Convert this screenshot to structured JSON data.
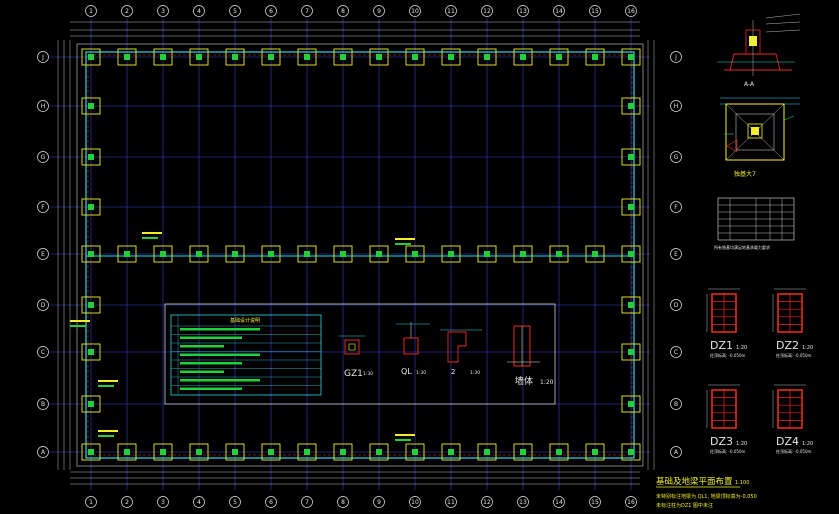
{
  "colors": {
    "background": "#000000",
    "axis_line": "#3a3fd8",
    "grid_blue": "#2a2f9a",
    "outline": "#8c8c8c",
    "green": "#22d03a",
    "yellow": "#f2ef2a",
    "red": "#e8281e",
    "cyan": "#2fd6e6",
    "white": "#e6e6e6",
    "magenta": "#d43ad4"
  },
  "plan": {
    "col_labels": [
      "1",
      "2",
      "3",
      "4",
      "5",
      "6",
      "7",
      "8",
      "9",
      "10",
      "11",
      "12",
      "13",
      "14",
      "15",
      "16"
    ],
    "row_labels": [
      "J",
      "H",
      "G",
      "F",
      "E",
      "D",
      "C",
      "B",
      "A"
    ],
    "title": "基础及地梁平面布置",
    "title_scale": "1:100",
    "note_line1": "未特别标注地梁为 QL1, 地梁顶标高为-0.050",
    "note_line2": "未标注柱为DZ1  图中未注"
  },
  "notes_table": {
    "header": "基础设计说明"
  },
  "sections": {
    "gz1": "GZ1",
    "gz1_scale": "1:30",
    "ql": "QL",
    "ql_scale": "1:30",
    "detail_num": "2",
    "detail_scale": "1:30",
    "wall": "墙体",
    "wall_scale": "1:20"
  },
  "details": {
    "a_a": "A-A",
    "jiangda": "独基大7",
    "table_note": "所有独基均满足地基承载力要求"
  },
  "columns": [
    {
      "name": "DZ1",
      "scale": "1:20",
      "note": "柱顶标高: -0.050m"
    },
    {
      "name": "DZ2",
      "scale": "1:20",
      "note": "柱顶标高: -0.050m"
    },
    {
      "name": "DZ3",
      "scale": "1:20",
      "note": "柱顶标高: -0.050m"
    },
    {
      "name": "DZ4",
      "scale": "1:20",
      "note": "柱顶标高: -0.050m"
    }
  ]
}
